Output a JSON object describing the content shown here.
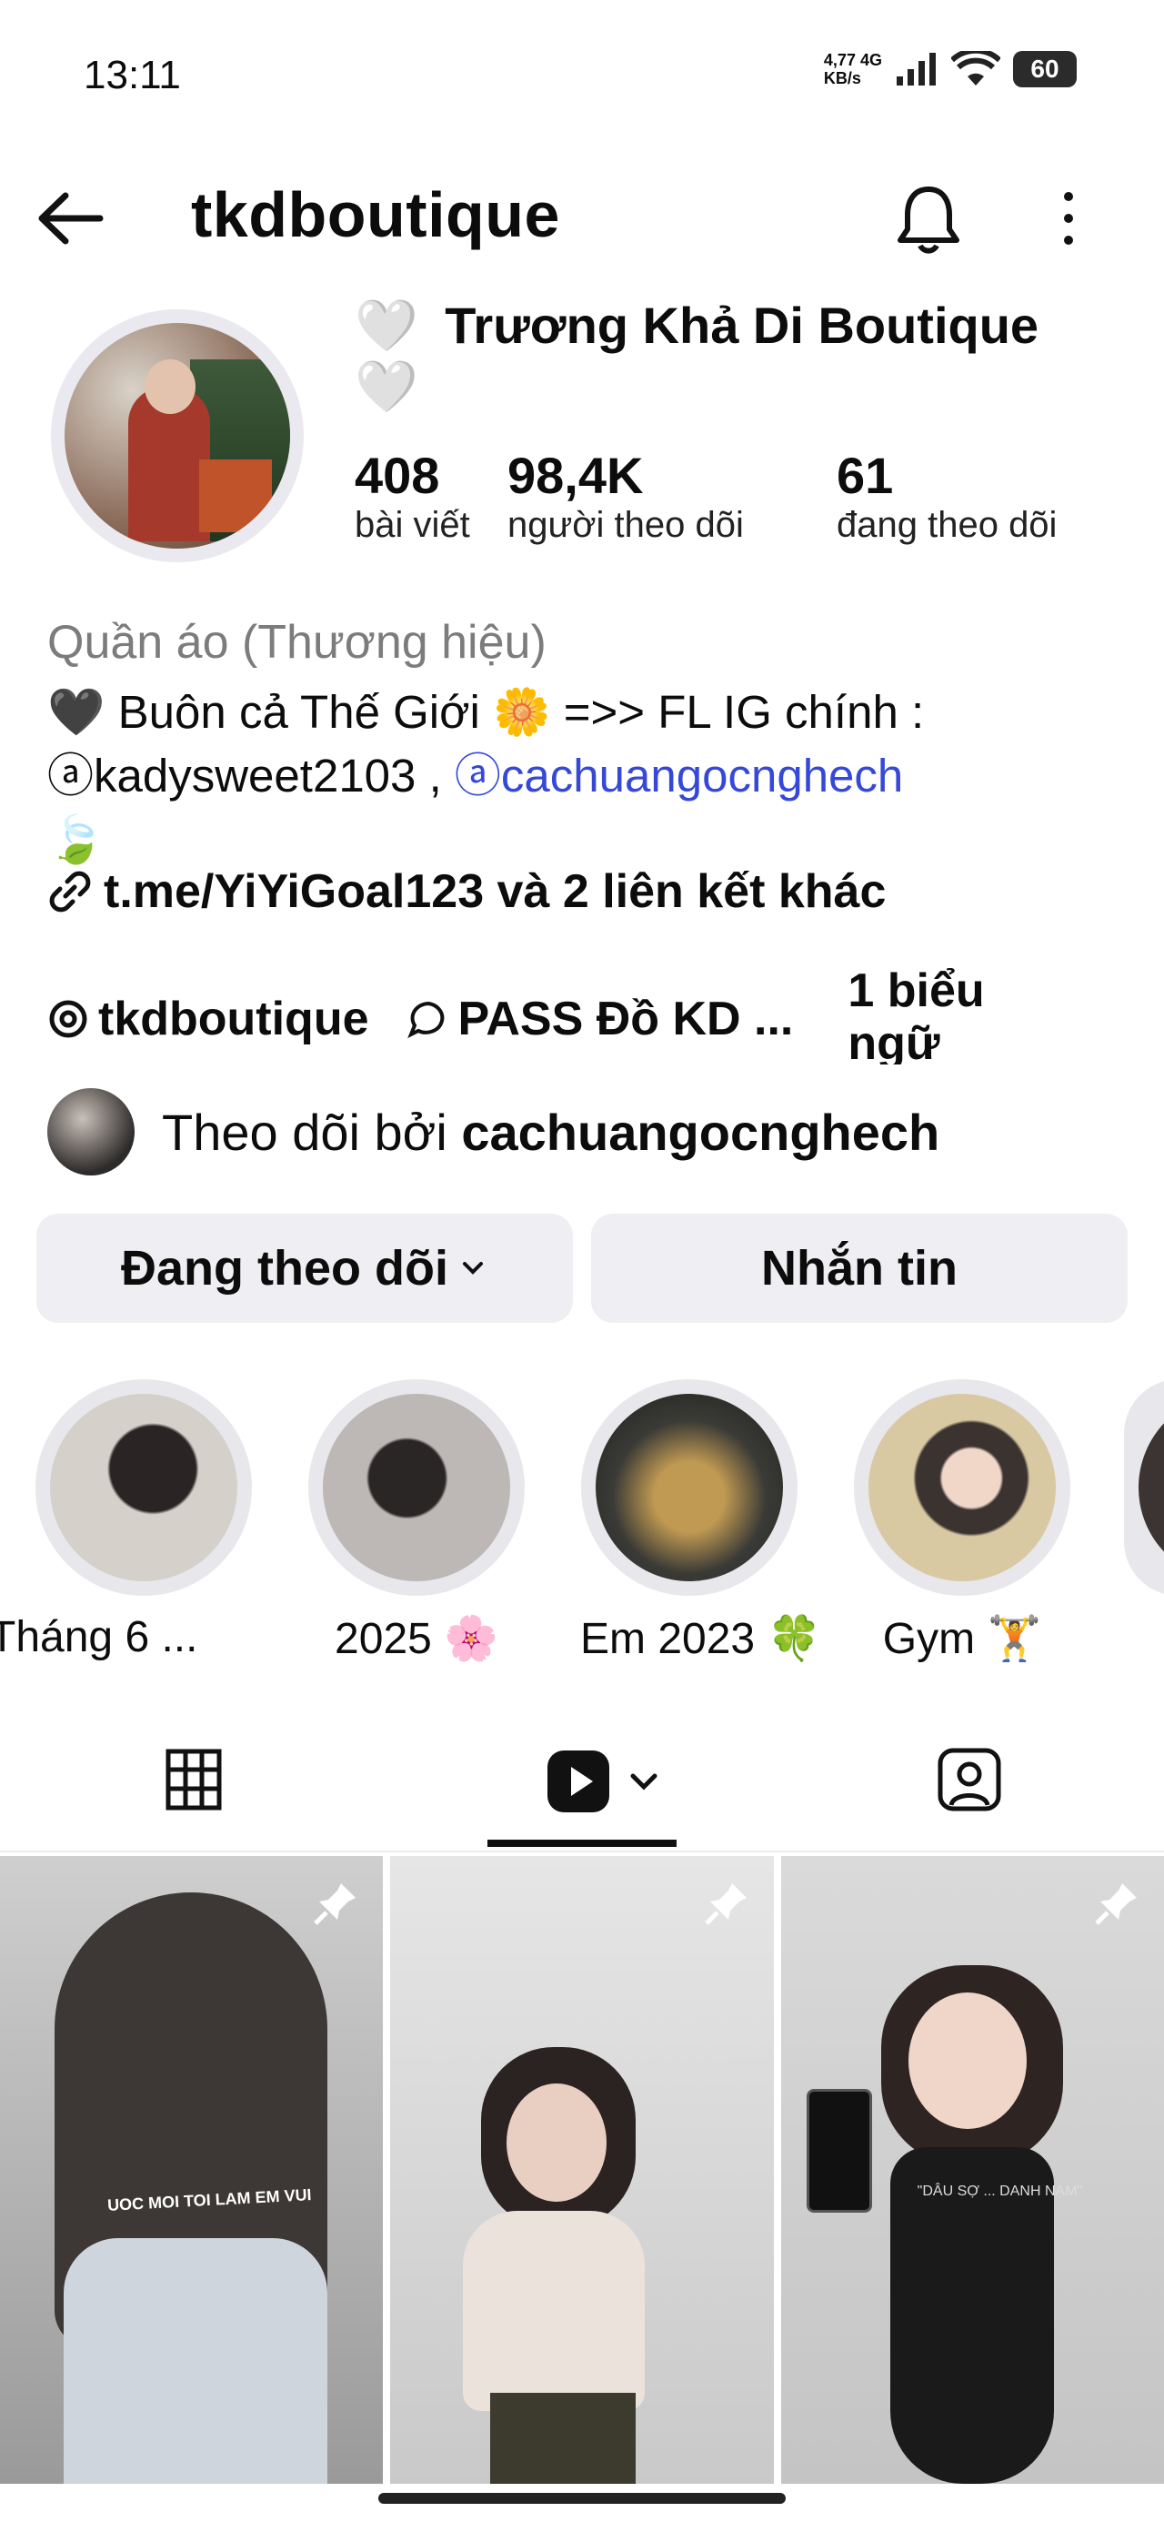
{
  "status_bar": {
    "time": "13:11",
    "net_speed_value": "4,77",
    "net_speed_unit": "KB/s",
    "network": "4G",
    "battery": "60"
  },
  "header": {
    "username": "tkdboutique",
    "back_icon": "arrow-left-icon",
    "bell_icon": "bell-icon",
    "menu_icon": "kebab-icon"
  },
  "profile": {
    "heart1": "🤍",
    "heart2": "🤍",
    "display_name": "Trương Khả Di Boutique",
    "stats": [
      {
        "value": "408",
        "label": "bài viết"
      },
      {
        "value": "98,4K",
        "label": "người theo dõi"
      },
      {
        "value": "61",
        "label": "đang theo dõi"
      }
    ],
    "category": "Quần áo (Thương hiệu)",
    "bio_line1": "🖤 Buôn cả Thế Giới 🌼 =>> FL IG chính :",
    "bio_mention1": "ⓐkadysweet2103 ,",
    "bio_mention2": "ⓐcachuangocnghech",
    "bio_emoji": "🍃",
    "link_text": "t.me/YiYiGoal123 và 2 liên kết khác",
    "threads_chip": "tkdboutique",
    "thread_chip2": "PASS Đồ KD ...",
    "banner_chip_line1": "1 biểu",
    "banner_chip_line2": "ngữ",
    "followed_by_prefix": "Theo dõi bởi",
    "followed_by_user": "cachuangocnghech"
  },
  "actions": {
    "following_label": "Đang theo dõi",
    "message_label": "Nhắn tin"
  },
  "highlights": [
    {
      "label": "Tháng 6 ...",
      "color": "#cfc9c6"
    },
    {
      "label": "2025 🌸",
      "color": "#bdb7b5"
    },
    {
      "label": "Em 2023 🍀",
      "color": "#6a5a3c"
    },
    {
      "label": "Gym 🏋️",
      "color": "#d4c7a6"
    }
  ],
  "tabs": {
    "grid_icon": "grid-icon",
    "reels_icon": "reels-icon",
    "tagged_icon": "tagged-icon",
    "active": "reels"
  },
  "tiles": [
    {
      "overlay_text": "UOC MOI TOI LAM EM VUI",
      "pinned": true
    },
    {
      "overlay_text": "",
      "pinned": true
    },
    {
      "overlay_text": "\"DÂU SỢ ... DANH NẠM\"",
      "pinned": true
    }
  ],
  "colors": {
    "accent_link": "#3648d8",
    "button_bg": "#efeff3"
  }
}
